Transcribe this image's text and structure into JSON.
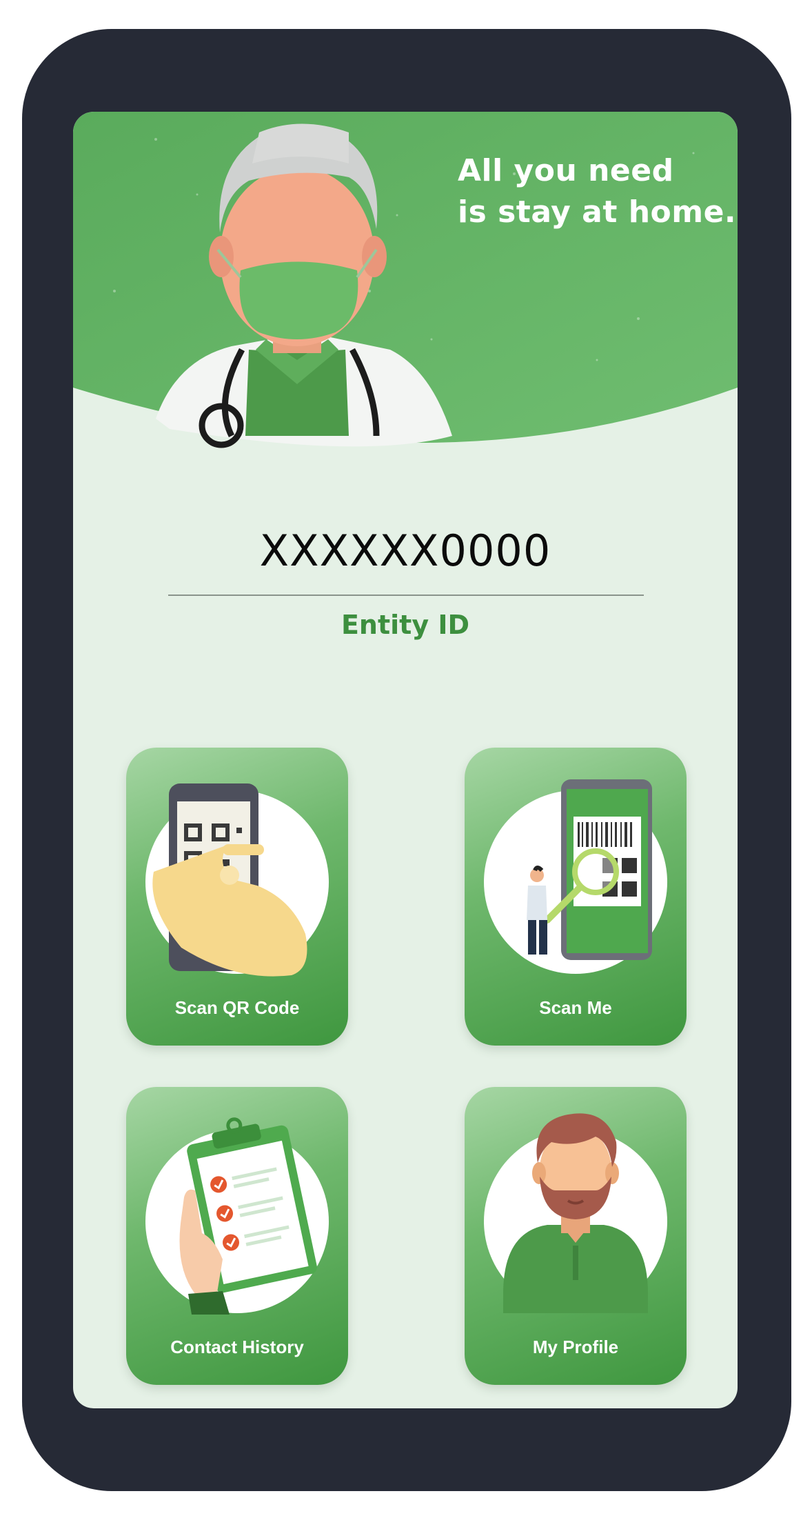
{
  "hero": {
    "tagline_line1": "All you need",
    "tagline_line2": "is stay at home."
  },
  "entity": {
    "value": "XXXXXX0000",
    "label": "Entity ID"
  },
  "menu": [
    {
      "label": "Scan QR Code",
      "icon": "scan-qr-icon"
    },
    {
      "label": "Scan Me",
      "icon": "scan-me-icon"
    },
    {
      "label": "Contact History",
      "icon": "contact-history-icon"
    },
    {
      "label": "My Profile",
      "icon": "profile-icon"
    }
  ],
  "colors": {
    "phone_frame": "#262a36",
    "screen_background": "#e5f1e6",
    "hero_green": "#5cae5e",
    "entity_label": "#3d8f3f",
    "card_gradient_light": "#a6d6a4",
    "card_gradient_dark": "#3f973f"
  }
}
